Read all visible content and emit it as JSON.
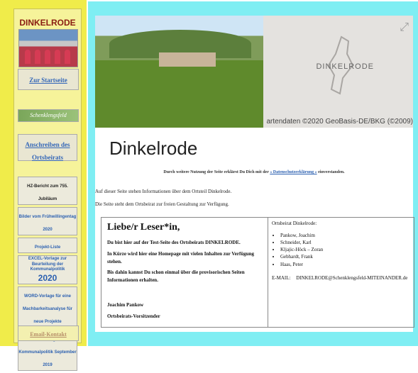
{
  "sidebar": {
    "title": "DINKELRODE",
    "start_link": "Zur Startseite",
    "logo_text": "Schenklengsfeld",
    "write_link": "Anschreiben des Ortsbeirats",
    "tiles": [
      "HZ-Bericht zum 755. Jubiläum",
      "Bilder vom Frühwillingentag 2020",
      "Projekt-Liste",
      "EXCEL-Vorlage zur Beurteilung der Kommunalpolitik",
      "WORD-Vorlage für eine Machbarkeitsanalyse für neue Projekte",
      "Beurteilung der Kommunalpolitik September 2019"
    ],
    "year_2020": "2020",
    "email_link": "Email-Kontakt"
  },
  "map": {
    "label": "DINKELRODE",
    "credit": "artendaten ©2020 GeoBasis-DE/BKG (©2009)"
  },
  "banner": {
    "title": "Dinkelrode"
  },
  "notice": {
    "prefix": "Durch weitere Nutzung der Seite erklärst Du Dich mit der",
    "link": "« Datenschutzerklärung »",
    "suffix": "einverstanden."
  },
  "intro": {
    "line1": "Auf dieser Seite stehen Informationen über dem Ortsteil Dinkelrode.",
    "line2": "Die Seite steht dem Ortsbeirat zur freien Gestaltung zur Verfügung."
  },
  "letter": {
    "greeting": "Liebe/r Leser*in,",
    "p1": "Du bist hier auf der Test-Seite des Ortsbeirats DINKELRODE.",
    "p2": "In Kürze wird hier eine Homepage mit vielen Inhalten zur Verfügung stehen.",
    "p3": "Bis dahin kannst Du schon einmal über die provisorischen Seiten Informationen erhalten.",
    "signature_name": "Joachim Pankow",
    "signature_role": "Ortsbeirats-Vorsitzender"
  },
  "board": {
    "heading": "Ortsbeirat Dinkelrode:",
    "members": [
      "Pankow, Joachim",
      "Schneider, Karl",
      "Kljajic-Höck – Zoran",
      "Gebhardt, Frank",
      "Haas, Peter"
    ],
    "email_label": "E-MAIL:",
    "email": "DINKELRODE@Schenklengsfeld-MITEINANDER.de"
  }
}
